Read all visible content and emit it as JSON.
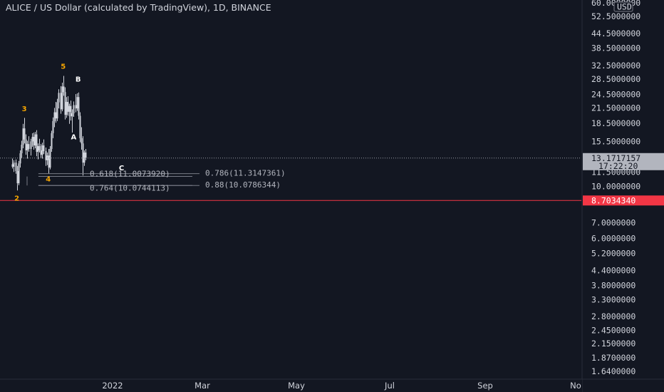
{
  "title": "ALICE / US Dollar (calculated by TradingView), 1D, BINANCE",
  "currency": "USD",
  "colors": {
    "background": "#131722",
    "text": "#d1d4dc",
    "candle": "#d1d4dc",
    "support": "#f23645",
    "wave_orange": "#f7a600",
    "wave_white": "#ffffff",
    "price_label_bg": "#b2b5be"
  },
  "chart_data": {
    "type": "candlestick",
    "title": "ALICE / US Dollar (calculated by TradingView), 1D, BINANCE",
    "y_scale": "log",
    "ylim": [
      1.5,
      60
    ],
    "y_ticks": [
      "60.0000000",
      "52.5000000",
      "44.5000000",
      "38.5000000",
      "32.5000000",
      "28.5000000",
      "24.5000000",
      "21.5000000",
      "18.5000000",
      "15.5000000",
      "11.5000000",
      "10.0000000",
      "7.0000000",
      "6.0000000",
      "5.2000000",
      "4.4000000",
      "3.8000000",
      "3.3000000",
      "2.8000000",
      "2.4500000",
      "2.1500000",
      "1.8700000",
      "1.6400000"
    ],
    "x_ticks": [
      "2022",
      "Mar",
      "May",
      "Jul",
      "Sep",
      "No"
    ],
    "current_price": {
      "value": 13.1717157,
      "label": "13.1717157",
      "countdown": "17:22:20"
    },
    "support": {
      "value": 8.703434,
      "label": "8.7034340"
    },
    "wave_labels": [
      {
        "text": "3",
        "price": 20.8,
        "date": "2021-11-02",
        "color": "orange"
      },
      {
        "text": "5",
        "price": 31.5,
        "date": "2021-11-28",
        "color": "orange"
      },
      {
        "text": "B",
        "price": 27.8,
        "date": "2021-12-08",
        "color": "white"
      },
      {
        "text": "A",
        "price": 15.8,
        "date": "2021-12-05",
        "color": "white"
      },
      {
        "text": "4",
        "price": 10.5,
        "date": "2021-11-18",
        "color": "orange"
      },
      {
        "text": "C",
        "price": 11.7,
        "date": "2022-01-06",
        "color": "white"
      },
      {
        "text": "2",
        "price": 8.7,
        "date": "2021-10-28",
        "color": "orange"
      }
    ],
    "fib_levels": [
      {
        "ratio": "0.786",
        "value": 11.3147361,
        "label": "0.786(11.3147361)"
      },
      {
        "ratio": "0.618",
        "value": 11.007392,
        "label": "0.618(11.0073920)"
      },
      {
        "ratio": "0.88",
        "value": 10.0786344,
        "label": "0.88(10.0786344)"
      },
      {
        "ratio": "0.764",
        "value": 10.0744113,
        "label": "0.764(10.0744113)"
      }
    ],
    "candles": [
      {
        "date": "2021-10-25",
        "open": 12.4,
        "high": 13.1,
        "low": 11.9,
        "close": 12.1
      },
      {
        "date": "2021-10-26",
        "open": 12.1,
        "high": 12.9,
        "low": 11.5,
        "close": 12.6
      },
      {
        "date": "2021-10-27",
        "open": 12.6,
        "high": 13.0,
        "low": 11.3,
        "close": 11.6
      },
      {
        "date": "2021-10-28",
        "open": 11.6,
        "high": 12.2,
        "low": 9.6,
        "close": 10.3
      },
      {
        "date": "2021-10-29",
        "open": 10.3,
        "high": 12.8,
        "low": 10.1,
        "close": 12.5
      },
      {
        "date": "2021-10-30",
        "open": 12.5,
        "high": 14.2,
        "low": 12.0,
        "close": 13.8
      },
      {
        "date": "2021-10-31",
        "open": 13.8,
        "high": 15.6,
        "low": 13.2,
        "close": 15.0
      },
      {
        "date": "2021-11-01",
        "open": 15.0,
        "high": 18.4,
        "low": 14.5,
        "close": 17.6
      },
      {
        "date": "2021-11-02",
        "open": 17.6,
        "high": 19.5,
        "low": 15.2,
        "close": 15.8
      },
      {
        "date": "2021-11-03",
        "open": 15.8,
        "high": 16.6,
        "low": 13.6,
        "close": 14.2
      },
      {
        "date": "2021-11-04",
        "open": 14.2,
        "high": 15.6,
        "low": 13.1,
        "close": 15.1
      },
      {
        "date": "2021-11-05",
        "open": 15.1,
        "high": 16.3,
        "low": 14.0,
        "close": 14.4
      },
      {
        "date": "2021-11-06",
        "open": 14.4,
        "high": 15.9,
        "low": 13.5,
        "close": 15.5
      },
      {
        "date": "2021-11-07",
        "open": 15.5,
        "high": 16.8,
        "low": 14.7,
        "close": 16.2
      },
      {
        "date": "2021-11-08",
        "open": 16.2,
        "high": 16.9,
        "low": 14.3,
        "close": 14.9
      },
      {
        "date": "2021-11-09",
        "open": 14.9,
        "high": 17.0,
        "low": 14.5,
        "close": 16.6
      },
      {
        "date": "2021-11-10",
        "open": 16.6,
        "high": 17.3,
        "low": 13.4,
        "close": 14.0
      },
      {
        "date": "2021-11-11",
        "open": 14.0,
        "high": 15.2,
        "low": 13.0,
        "close": 14.8
      },
      {
        "date": "2021-11-12",
        "open": 14.8,
        "high": 15.9,
        "low": 13.9,
        "close": 14.2
      },
      {
        "date": "2021-11-13",
        "open": 14.2,
        "high": 15.1,
        "low": 13.2,
        "close": 13.6
      },
      {
        "date": "2021-11-14",
        "open": 13.6,
        "high": 15.3,
        "low": 13.1,
        "close": 14.9
      },
      {
        "date": "2021-11-15",
        "open": 14.9,
        "high": 15.8,
        "low": 13.7,
        "close": 14.1
      },
      {
        "date": "2021-11-16",
        "open": 14.1,
        "high": 14.6,
        "low": 12.2,
        "close": 12.9
      },
      {
        "date": "2021-11-17",
        "open": 12.9,
        "high": 13.9,
        "low": 12.3,
        "close": 13.5
      },
      {
        "date": "2021-11-18",
        "open": 13.5,
        "high": 14.4,
        "low": 11.3,
        "close": 12.0
      },
      {
        "date": "2021-11-19",
        "open": 12.0,
        "high": 14.8,
        "low": 11.8,
        "close": 14.4
      },
      {
        "date": "2021-11-20",
        "open": 14.4,
        "high": 17.2,
        "low": 14.0,
        "close": 16.8
      },
      {
        "date": "2021-11-21",
        "open": 16.8,
        "high": 19.6,
        "low": 16.0,
        "close": 18.9
      },
      {
        "date": "2021-11-22",
        "open": 18.9,
        "high": 21.5,
        "low": 17.8,
        "close": 20.6
      },
      {
        "date": "2021-11-23",
        "open": 20.6,
        "high": 22.8,
        "low": 18.6,
        "close": 19.4
      },
      {
        "date": "2021-11-24",
        "open": 19.4,
        "high": 23.5,
        "low": 18.9,
        "close": 22.7
      },
      {
        "date": "2021-11-25",
        "open": 22.7,
        "high": 25.8,
        "low": 21.4,
        "close": 24.9
      },
      {
        "date": "2021-11-26",
        "open": 24.9,
        "high": 26.6,
        "low": 20.3,
        "close": 21.2
      },
      {
        "date": "2021-11-27",
        "open": 21.2,
        "high": 27.5,
        "low": 20.8,
        "close": 26.5
      },
      {
        "date": "2021-11-28",
        "open": 26.5,
        "high": 29.4,
        "low": 24.2,
        "close": 25.1
      },
      {
        "date": "2021-11-29",
        "open": 25.1,
        "high": 26.3,
        "low": 19.2,
        "close": 20.1
      },
      {
        "date": "2021-11-30",
        "open": 20.1,
        "high": 23.9,
        "low": 19.5,
        "close": 22.8
      },
      {
        "date": "2021-12-01",
        "open": 22.8,
        "high": 24.1,
        "low": 19.9,
        "close": 20.7
      },
      {
        "date": "2021-12-02",
        "open": 20.7,
        "high": 22.4,
        "low": 18.4,
        "close": 21.9
      },
      {
        "date": "2021-12-03",
        "open": 21.9,
        "high": 23.1,
        "low": 19.0,
        "close": 19.8
      },
      {
        "date": "2021-12-04",
        "open": 19.8,
        "high": 21.2,
        "low": 16.9,
        "close": 20.4
      },
      {
        "date": "2021-12-05",
        "open": 20.4,
        "high": 22.9,
        "low": 19.7,
        "close": 22.1
      },
      {
        "date": "2021-12-06",
        "open": 22.1,
        "high": 24.6,
        "low": 20.6,
        "close": 21.4
      },
      {
        "date": "2021-12-07",
        "open": 21.4,
        "high": 24.8,
        "low": 20.9,
        "close": 23.9
      },
      {
        "date": "2021-12-08",
        "open": 23.9,
        "high": 25.0,
        "low": 19.2,
        "close": 19.9
      },
      {
        "date": "2021-12-09",
        "open": 19.9,
        "high": 20.6,
        "low": 15.4,
        "close": 16.0
      },
      {
        "date": "2021-12-10",
        "open": 16.0,
        "high": 17.8,
        "low": 14.3,
        "close": 15.2
      },
      {
        "date": "2021-12-11",
        "open": 15.2,
        "high": 16.3,
        "low": 11.1,
        "close": 12.6
      },
      {
        "date": "2021-12-12",
        "open": 12.6,
        "high": 14.2,
        "low": 12.2,
        "close": 13.9
      },
      {
        "date": "2021-12-13",
        "open": 13.9,
        "high": 14.4,
        "low": 12.9,
        "close": 13.2
      }
    ]
  }
}
